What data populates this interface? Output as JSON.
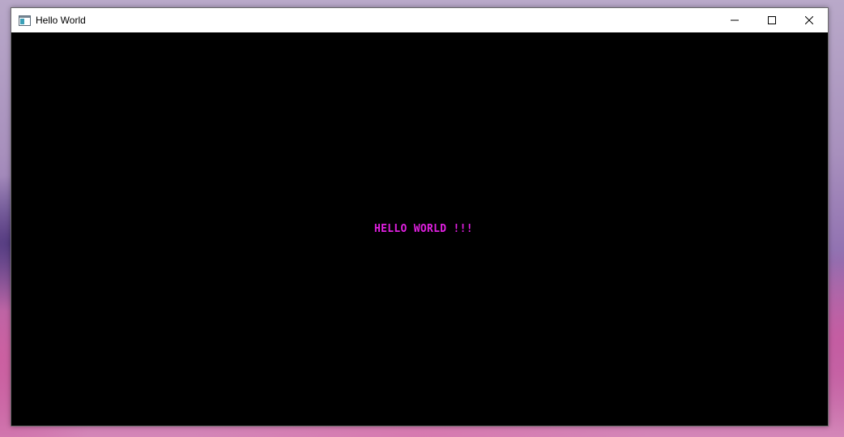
{
  "window": {
    "title": "Hello World",
    "icon": "app-window-icon",
    "controls": [
      "minimize-icon",
      "maximize-icon",
      "close-icon"
    ]
  },
  "content": {
    "message": "HELLO WORLD !!!",
    "message_color": "#e020e0",
    "background_color": "#000000"
  }
}
